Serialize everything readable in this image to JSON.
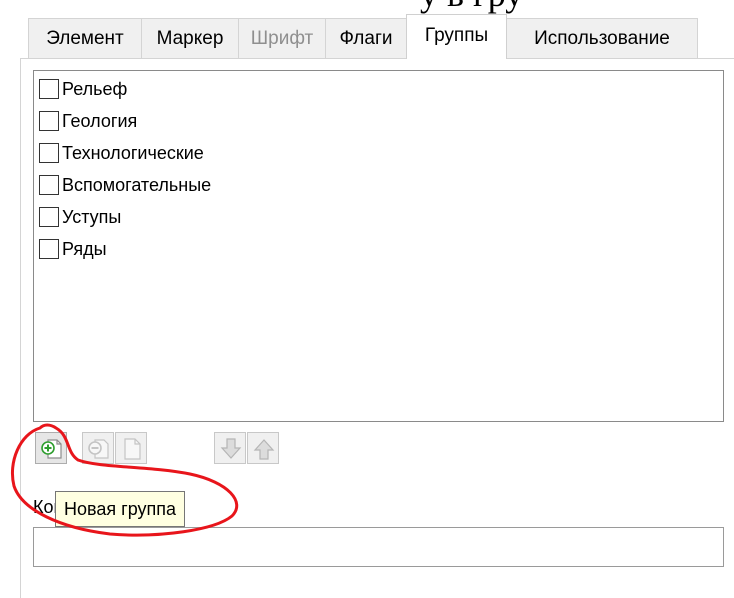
{
  "heading": "у   в  гру",
  "tabs": [
    {
      "label": "Элемент",
      "state": "normal"
    },
    {
      "label": "Маркер",
      "state": "normal"
    },
    {
      "label": "Шрифт",
      "state": "disabled"
    },
    {
      "label": "Флаги",
      "state": "normal"
    },
    {
      "label": "Группы",
      "state": "active"
    },
    {
      "label": "Использование",
      "state": "normal"
    }
  ],
  "groups": {
    "items": [
      {
        "label": "Рельеф",
        "checked": false
      },
      {
        "label": "Геология",
        "checked": false
      },
      {
        "label": "Технологические",
        "checked": false
      },
      {
        "label": "Вспомогательные",
        "checked": false
      },
      {
        "label": "Уступы",
        "checked": false
      },
      {
        "label": "Ряды",
        "checked": false
      }
    ]
  },
  "toolbar": {
    "buttons": [
      {
        "icon": "add-group-icon",
        "enabled": true
      },
      {
        "icon": "remove-group-icon",
        "enabled": false
      },
      {
        "icon": "document-icon",
        "enabled": false
      },
      {
        "icon": "arrow-down-icon",
        "enabled": false
      },
      {
        "icon": "arrow-up-icon",
        "enabled": false
      }
    ]
  },
  "tooltip": {
    "text": "Новая группа"
  },
  "comment": {
    "label": "Комментарий",
    "value": ""
  },
  "colors": {
    "annotation": "#e8151b",
    "add_icon": "#2e9e2e",
    "tooltip_bg": "#ffffe1",
    "disabled_text": "#8f8f8f"
  }
}
